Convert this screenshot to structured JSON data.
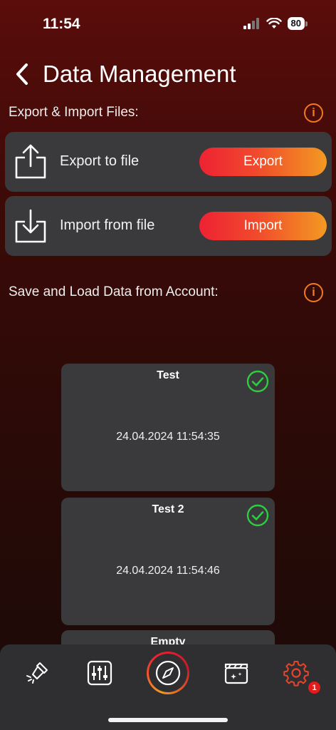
{
  "status_bar": {
    "time": "11:54",
    "battery": "80"
  },
  "header": {
    "title": "Data Management"
  },
  "export_import": {
    "section_label": "Export & Import Files:",
    "export": {
      "label": "Export to file",
      "button": "Export"
    },
    "import": {
      "label": "Import from file",
      "button": "Import"
    }
  },
  "account": {
    "section_label": "Save and Load Data from Account:",
    "slots": [
      {
        "name": "Test",
        "date": "24.04.2024 11:54:35",
        "saved": true
      },
      {
        "name": "Test 2",
        "date": "24.04.2024 11:54:46",
        "saved": true
      },
      {
        "name": "Empty",
        "date": "",
        "saved": false
      }
    ]
  },
  "tab_bar": {
    "tabs": [
      "flashlight-icon",
      "sliders-icon",
      "compass-icon",
      "clapperboard-icon",
      "gear-icon"
    ],
    "settings_badge": "1"
  },
  "colors": {
    "accent_start": "#ee2233",
    "accent_end": "#f39a22",
    "success": "#2ecc40",
    "card": "#3a3a3c"
  }
}
